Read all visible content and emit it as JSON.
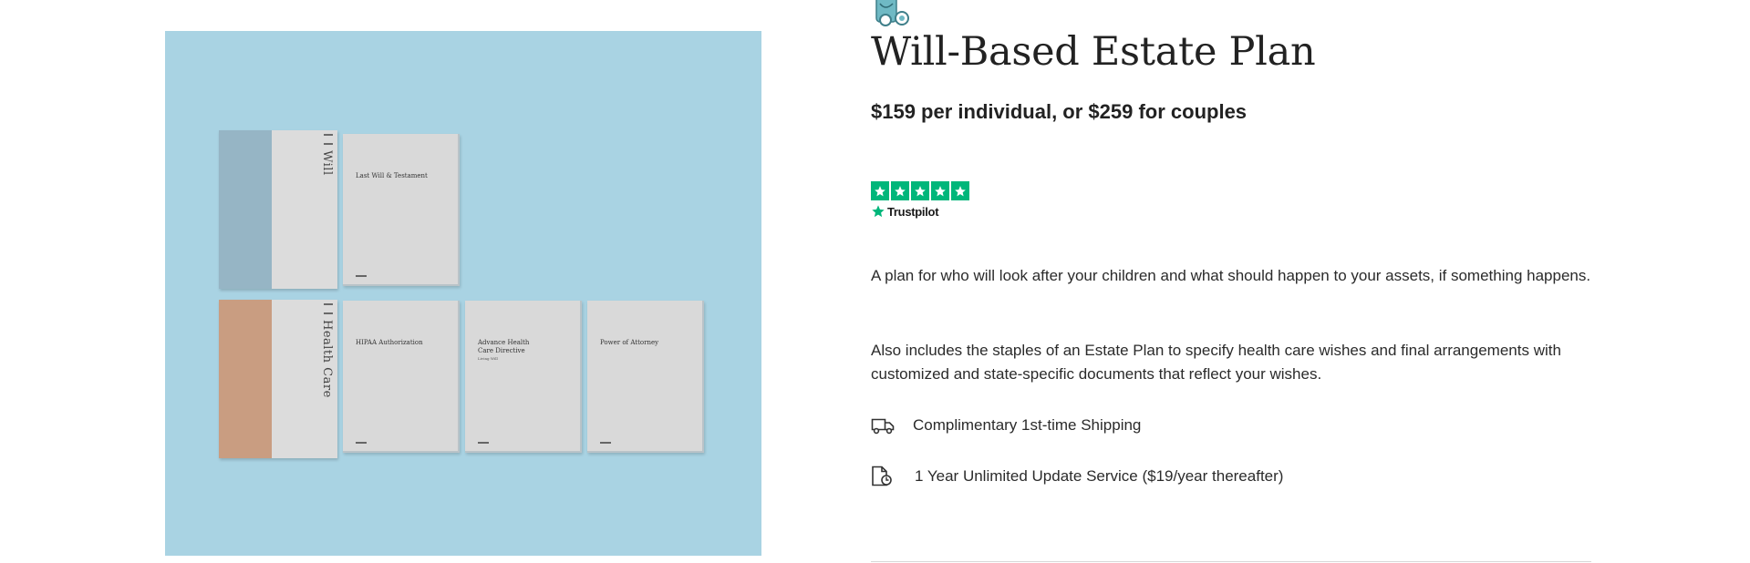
{
  "product": {
    "title": "Will-Based Estate Plan",
    "price": "$159 per individual, or $259 for couples"
  },
  "rating": {
    "provider": "Trustpilot",
    "stars": 5,
    "star_color": "#00b67a"
  },
  "description": [
    "A plan for who will look after your children and what should happen to your assets, if something happens.",
    "Also includes the staples of an Estate Plan to specify health care wishes and final arrangements with customized and state-specific documents that reflect your wishes."
  ],
  "features": [
    {
      "icon": "truck-icon",
      "label": "Complimentary 1st-time Shipping"
    },
    {
      "icon": "document-refresh-icon",
      "label": "1 Year Unlimited Update Service ($19/year thereafter)"
    }
  ],
  "product_image": {
    "background": "#a9d3e3",
    "binders": [
      {
        "spine_title": "Will",
        "tab_color": "#96b5c5"
      },
      {
        "spine_title": "Health Care",
        "tab_color": "#c99d81"
      }
    ],
    "documents": [
      {
        "title": "Last Will & Testament",
        "subtitle": ""
      },
      {
        "title": "HIPAA Authorization",
        "subtitle": ""
      },
      {
        "title": "Advance Health Care Directive",
        "subtitle": "Living Will"
      },
      {
        "title": "Power of Attorney",
        "subtitle": ""
      }
    ]
  }
}
